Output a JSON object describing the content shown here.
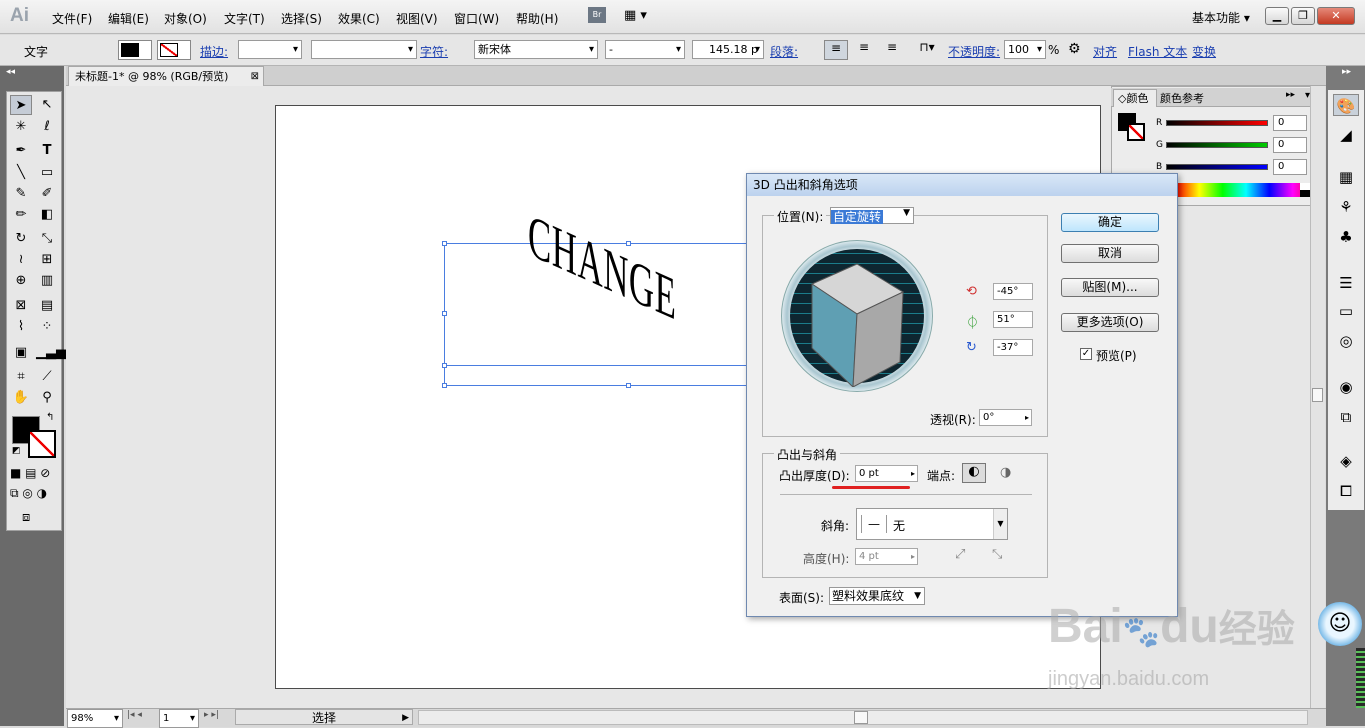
{
  "app": {
    "logo": "Ai",
    "workspace": "基本功能"
  },
  "menu": [
    "文件(F)",
    "编辑(E)",
    "对象(O)",
    "文字(T)",
    "选择(S)",
    "效果(C)",
    "视图(V)",
    "窗口(W)",
    "帮助(H)"
  ],
  "bridge_label": "Br",
  "control": {
    "tool_label": "文字",
    "stroke_label": "描边:",
    "char_label": "字符:",
    "font": "新宋体",
    "font_style": "-",
    "font_size": "145.18 p",
    "para_label": "段落:",
    "opacity_label": "不透明度:",
    "opacity": "100",
    "opacity_unit": "%",
    "align_label": "对齐",
    "flash_label": "Flash 文本",
    "transform_label": "变换"
  },
  "document": {
    "tab_title": "未标题-1* @ 98% (RGB/预览)",
    "art_text": "CHANGE"
  },
  "color_panel": {
    "tab1": "颜色",
    "tab2": "颜色参考",
    "r_label": "R",
    "g_label": "G",
    "b_label": "B",
    "r": "0",
    "g": "0",
    "b": "0"
  },
  "dialog": {
    "title": "3D 凸出和斜角选项",
    "position_label": "位置(N):",
    "position_value": "自定旋转",
    "rot_x": "-45°",
    "rot_y": "51°",
    "rot_z": "-37°",
    "perspective_label": "透视(R):",
    "perspective_value": "0°",
    "extrude_group": "凸出与斜角",
    "depth_label": "凸出厚度(D):",
    "depth_value": "0 pt",
    "cap_label": "端点:",
    "bevel_label": "斜角:",
    "bevel_value": "无",
    "height_label": "高度(H):",
    "height_value": "4 pt",
    "surface_label": "表面(S):",
    "surface_value": "塑料效果底纹",
    "ok": "确定",
    "cancel": "取消",
    "map": "贴图(M)...",
    "more": "更多选项(O)",
    "preview": "预览(P)"
  },
  "status": {
    "zoom": "98%",
    "page": "1",
    "mode": "选择"
  },
  "watermark": {
    "brand": "Bai",
    "brand2": "du",
    "cn": "经验",
    "url": "jingyan.baidu.com"
  },
  "colors": {
    "accent": "#4a7de0",
    "underline": "#e02020",
    "dialog_border": "#6f89b0"
  }
}
